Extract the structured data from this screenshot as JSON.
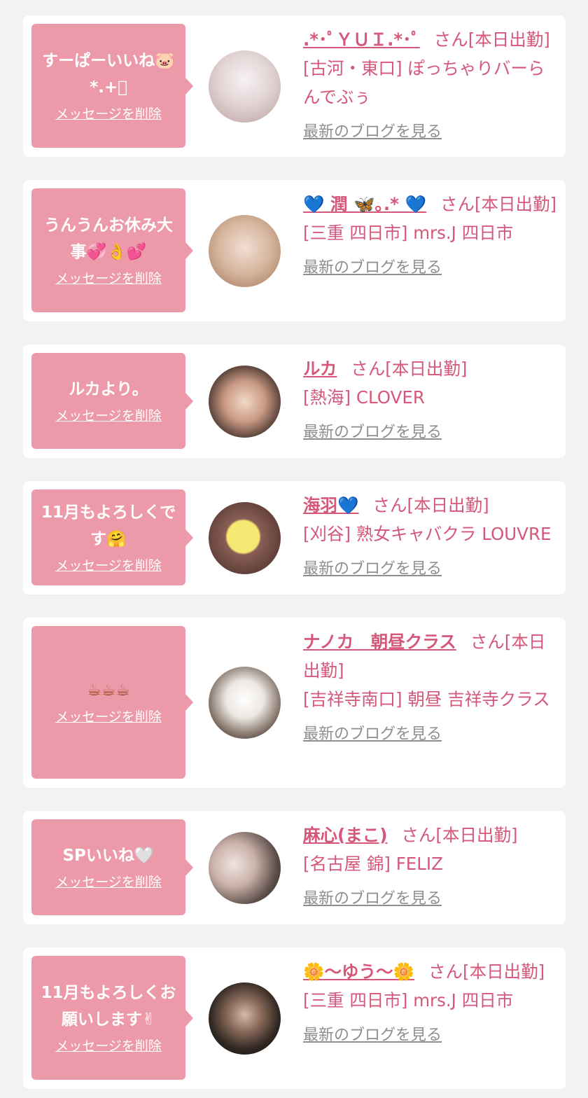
{
  "delete_label": "メッセージを削除",
  "blog_label": "最新のブログを見る",
  "cards": [
    {
      "message": "すーぱーいいね🐷 *.+ﾟ",
      "name": ".*･ﾟＹＵＩ.*･ﾟ",
      "suffix": "さん[本日出勤]",
      "shop": "[古河・東口] ぽっちゃりバーらんでぶぅ",
      "avatar_colors": [
        "#f7f1f2",
        "#b9a09c"
      ]
    },
    {
      "message": "うんうんお休み大事💞👌💕",
      "name": "💙 潤 🦋｡.* 💙",
      "suffix": "さん[本日出勤]",
      "shop": "[三重 四日市] mrs.J 四日市",
      "avatar_colors": [
        "#e8d2c8",
        "#b88f6e"
      ]
    },
    {
      "message": "ルカより。",
      "name": "ルカ",
      "suffix": "さん[本日出勤]",
      "shop": "[熱海] CLOVER",
      "avatar_colors": [
        "#f0d5c4",
        "#3c2a26"
      ]
    },
    {
      "message": "11月もよろしくです🤗",
      "name": "海羽💙",
      "suffix": "さん[本日出勤]",
      "shop": "[刈谷] 熟女キャバクラ LOUVRE",
      "avatar_colors": [
        "#5a3b36",
        "#f5e873"
      ]
    },
    {
      "message": "☕☕☕",
      "name": "ナノカ　朝昼クラス",
      "suffix": "さん[本日出勤]",
      "shop": "[吉祥寺南口] 朝昼 吉祥寺クラス",
      "avatar_colors": [
        "#ece7e2",
        "#4a3a32"
      ]
    },
    {
      "message": "SPいいね🤍",
      "name": "麻心(まこ)",
      "suffix": "さん[本日出勤]",
      "shop": "[名古屋 錦] FELIZ",
      "avatar_colors": [
        "#3d3533",
        "#efe3df"
      ]
    },
    {
      "message": "11月もよろしくお願いします✌",
      "name": "🌼〜ゆう〜🌼",
      "suffix": "さん[本日出勤]",
      "shop": "[三重 四日市] mrs.J 四日市",
      "avatar_colors": [
        "#2e2621",
        "#d7b9a6"
      ]
    }
  ]
}
